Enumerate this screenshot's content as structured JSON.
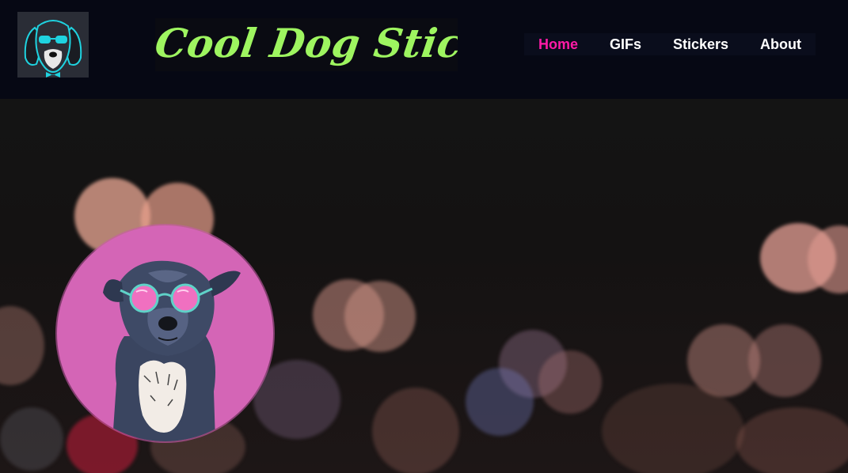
{
  "header": {
    "title": "Cool Dog Stickers",
    "logo_icon": "dog-with-sunglasses-logo"
  },
  "nav": {
    "items": [
      {
        "label": "Home",
        "active": true
      },
      {
        "label": "GIFs",
        "active": false
      },
      {
        "label": "Stickers",
        "active": false
      },
      {
        "label": "About",
        "active": false
      }
    ]
  },
  "hero": {
    "image_icon": "dog-with-pink-sunglasses-illustration"
  },
  "colors": {
    "header_bg": "#060814",
    "title_green": "#9ef560",
    "nav_active": "#ff1aa6",
    "nav_text": "#ffffff",
    "badge_pink": "#d465b6"
  }
}
